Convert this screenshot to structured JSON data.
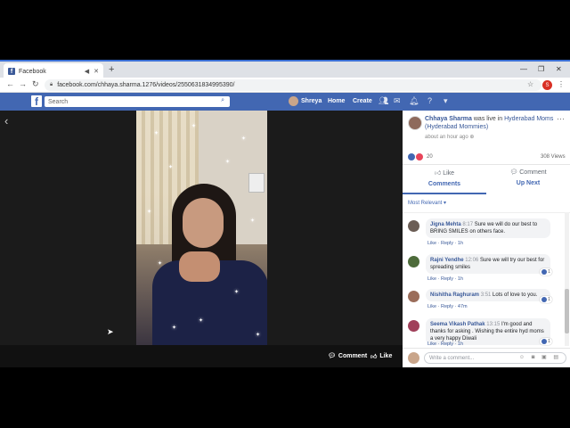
{
  "browser": {
    "tab_title": "Facebook",
    "url": "facebook.com/chhaya.sharma.1276/videos/2550631834995390/",
    "profile_letter": "S"
  },
  "fb": {
    "search_placeholder": "Search",
    "user_name": "Shreya",
    "nav_home": "Home",
    "nav_create": "Create"
  },
  "video": {
    "comment_label": "Comment",
    "like_label": "Like"
  },
  "post": {
    "author": "Chhaya Sharma",
    "was_live_in": "was live in",
    "location": "Hyderabad Moms (Hyderabad Mommies)",
    "time": "about an hour ago",
    "reaction_count": "20",
    "views": "308 Views",
    "like_label": "Like",
    "comment_label": "Comment",
    "tab_comments": "Comments",
    "tab_up_next": "Up Next",
    "sort_label": "Most Relevant ▾"
  },
  "comments": [
    {
      "name": "Jigna Mehta",
      "time": "8:17",
      "text": "Sure we will do our best to BRING SMILES on others face.",
      "meta": "Like · Reply · 1h",
      "likes": ""
    },
    {
      "name": "Rajni Yendhe",
      "time": "12:06",
      "text": "Sure we will try our best for spreading smiles",
      "meta": "Like · Reply · 1h",
      "likes": "1"
    },
    {
      "name": "Nishitha Raghuram",
      "time": "3:51",
      "text": "Lots of love to you.",
      "meta": "Like · Reply · 47m",
      "likes": "1"
    },
    {
      "name": "Seema Vikash Pathak",
      "time": "13:15",
      "text": "I'm good and thanks for asking . Wishing the entire hyd moms a very happy Diwali",
      "meta": "Like · Reply · 1h",
      "likes": "1"
    }
  ],
  "composer": {
    "placeholder": "Write a comment..."
  },
  "colors": {
    "fb_blue": "#4267b2",
    "link_blue": "#385898"
  }
}
